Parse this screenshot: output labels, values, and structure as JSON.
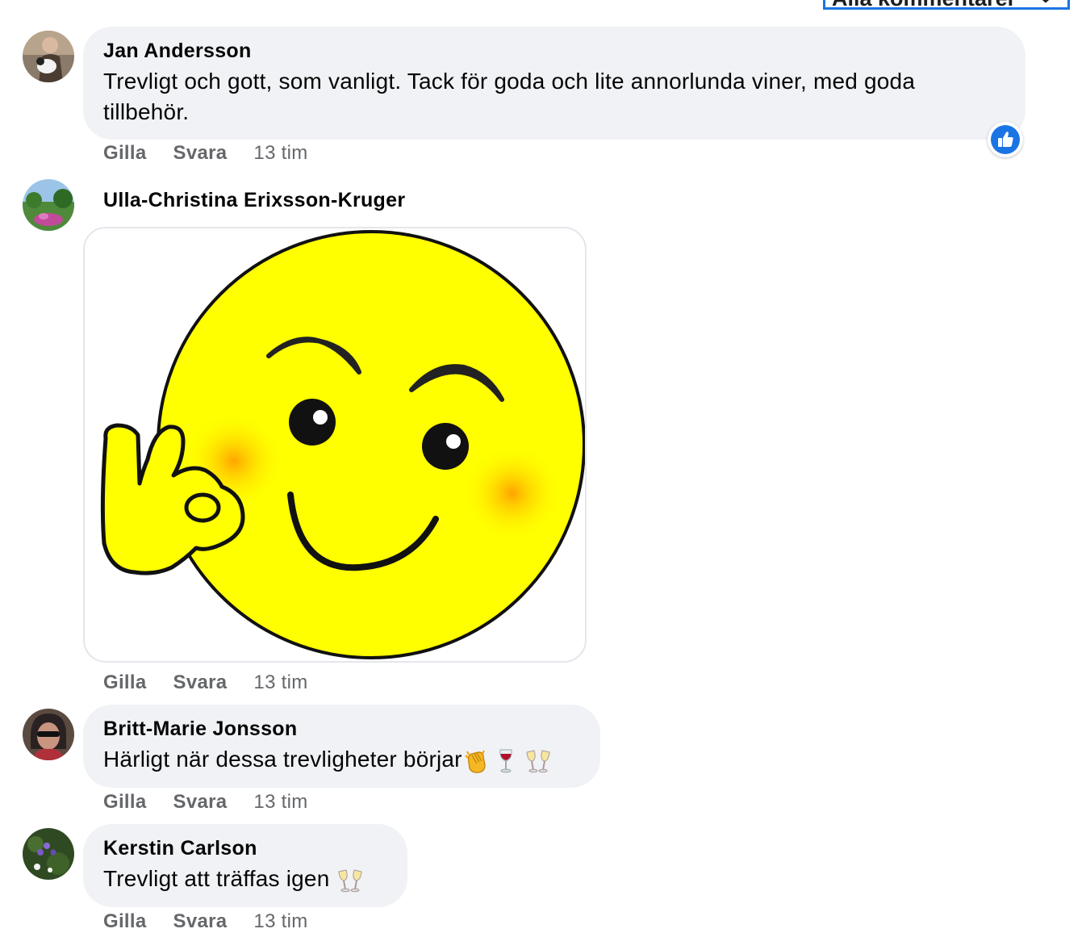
{
  "filter": {
    "label": "Alla kommentarer"
  },
  "comments": [
    {
      "author": "Jan Andersson",
      "text": "Trevligt och gott, som vanligt. Tack för goda och lite annorlunda viner, med goda",
      "text_line2": "tillbehör.",
      "actions": {
        "like": "Gilla",
        "reply": "Svara",
        "time": "13 tim"
      },
      "reactions": [
        "like-icon"
      ]
    },
    {
      "author": "Ulla-Christina Erixsson-Kruger",
      "attachment": "ok-hand-smiley-sticker",
      "actions": {
        "like": "Gilla",
        "reply": "Svara",
        "time": "13 tim"
      }
    },
    {
      "author": "Britt-Marie Jonsson",
      "text": "Härligt när dessa trevligheter börjar",
      "emojis": [
        "clapping-hands",
        "wine-glass",
        "clinking-glasses"
      ],
      "actions": {
        "like": "Gilla",
        "reply": "Svara",
        "time": "13 tim"
      }
    },
    {
      "author": "Kerstin Carlson",
      "text": "Trevligt att träffas igen",
      "emojis": [
        "clinking-glasses"
      ],
      "actions": {
        "like": "Gilla",
        "reply": "Svara",
        "time": "13 tim"
      }
    }
  ],
  "colors": {
    "bubble": "#f0f2f5",
    "meta": "#65676b",
    "accent": "#1b74e4",
    "sticker_yellow": "#ffff00"
  }
}
